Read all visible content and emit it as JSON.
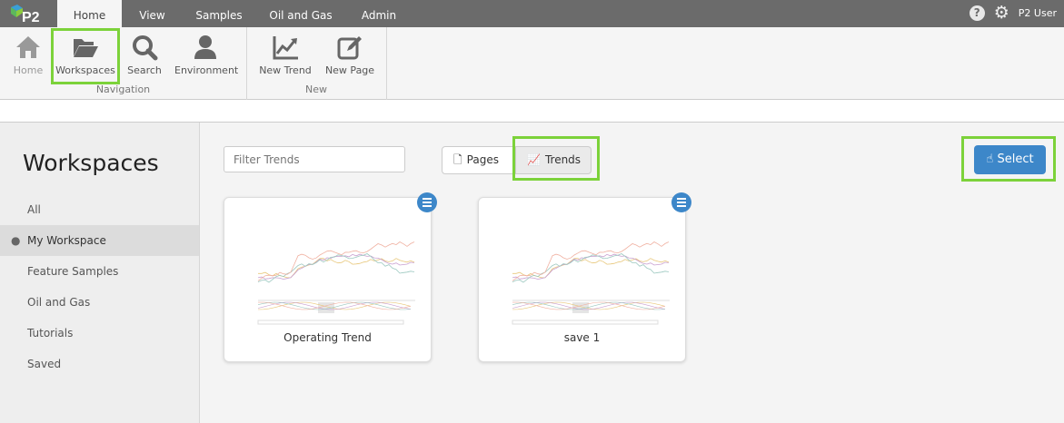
{
  "app": {
    "logo_text": "P2",
    "user": "P2 User"
  },
  "tabs": [
    {
      "label": "Home",
      "active": true
    },
    {
      "label": "View"
    },
    {
      "label": "Samples"
    },
    {
      "label": "Oil and Gas"
    },
    {
      "label": "Admin"
    }
  ],
  "ribbon": {
    "navigation": {
      "group_label": "Navigation",
      "buttons": [
        {
          "label": "Home"
        },
        {
          "label": "Workspaces"
        },
        {
          "label": "Search"
        },
        {
          "label": "Environment"
        }
      ]
    },
    "new": {
      "group_label": "New",
      "buttons": [
        {
          "label": "New Trend"
        },
        {
          "label": "New Page"
        }
      ]
    }
  },
  "sidebar": {
    "title": "Workspaces",
    "items": [
      {
        "label": "All"
      },
      {
        "label": "My Workspace",
        "selected": true
      },
      {
        "label": "Feature Samples"
      },
      {
        "label": "Oil and Gas"
      },
      {
        "label": "Tutorials"
      },
      {
        "label": "Saved"
      }
    ]
  },
  "main": {
    "filter_placeholder": "Filter Trends",
    "toggle": {
      "pages": "Pages",
      "trends": "Trends",
      "active": "Trends"
    },
    "select_label": "Select",
    "cards": [
      {
        "title": "Operating Trend"
      },
      {
        "title": "save 1"
      }
    ]
  },
  "colors": {
    "accent": "#3d87c9",
    "highlight": "#7cd23a",
    "topbar": "#6b6b6b"
  }
}
